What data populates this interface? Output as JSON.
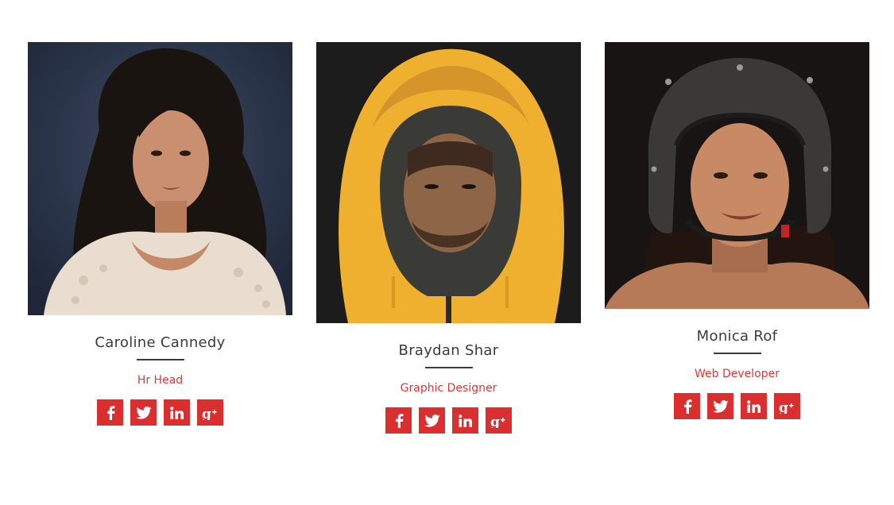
{
  "members": [
    {
      "name": "Caroline Cannedy",
      "role": "Hr Head",
      "colors": {
        "bg": "#2c3850",
        "accent": "#f1e3d3"
      }
    },
    {
      "name": "Braydan Shar",
      "role": "Graphic Designer",
      "colors": {
        "bg": "#1d1d1d",
        "accent": "#f3b43a"
      }
    },
    {
      "name": "Monica Rof",
      "role": "Web Developer",
      "colors": {
        "bg": "#1a1716",
        "accent": "#3d3d3d"
      }
    }
  ],
  "social_icons": [
    "facebook-icon",
    "twitter-icon",
    "linkedin-icon",
    "google-plus-icon"
  ],
  "theme": {
    "accent": "#db2f2f",
    "text": "#3b3b3b",
    "role": "#d63a3a"
  }
}
